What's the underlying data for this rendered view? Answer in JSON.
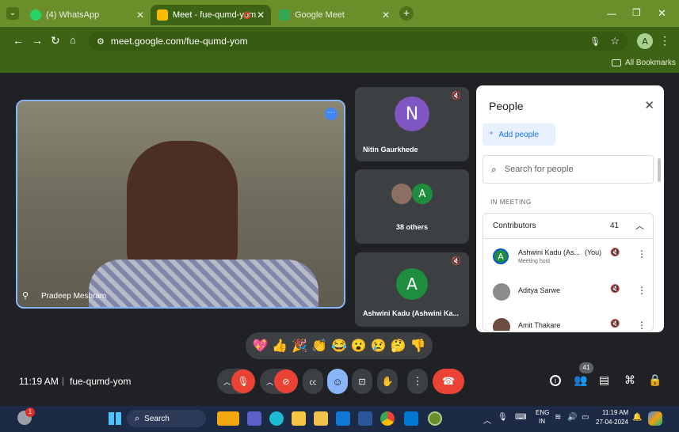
{
  "browser": {
    "tabs": [
      {
        "label": "(4) WhatsApp"
      },
      {
        "label": "Meet - fue-qumd-yom"
      },
      {
        "label": "Google Meet"
      }
    ],
    "url": "meet.google.com/fue-qumd-yom",
    "profile_initial": "A",
    "bookmarks_label": "All Bookmarks"
  },
  "meeting": {
    "main_tile_name": "Pradeep Meshram",
    "tiles": [
      {
        "initial": "N",
        "name": "Nitin Gaurkhede",
        "color": "#7e57c2"
      },
      {
        "initial": "A",
        "name": "38 others",
        "color": "#1e8e3e"
      },
      {
        "initial": "A",
        "name": "Ashwini Kadu (Ashwini Ka...",
        "color": "#1e8e3e"
      }
    ],
    "time": "11:19 AM",
    "divider": "|",
    "code": "fue-qumd-yom",
    "people_badge": "41"
  },
  "people_panel": {
    "title": "People",
    "add_people": "Add people",
    "search_placeholder": "Search for people",
    "section_label": "IN MEETING",
    "group_label": "Contributors",
    "group_count": "41",
    "members": [
      {
        "initial": "A",
        "name": "Ashwini Kadu (As...",
        "suffix": "(You)",
        "sub": "Meeting host"
      },
      {
        "initial": "",
        "name": "Aditya Sarwe",
        "suffix": "",
        "sub": ""
      },
      {
        "initial": "",
        "name": "Amit Thakare",
        "suffix": "",
        "sub": ""
      }
    ]
  },
  "reactions": [
    "💖",
    "👍",
    "🎉",
    "👏",
    "😂",
    "😮",
    "😢",
    "🤔",
    "👎"
  ],
  "taskbar": {
    "search_label": "Search",
    "lang": "ENG",
    "region": "IN",
    "clock_time": "11:19 AM",
    "clock_date": "27-04-2024",
    "notification_count": "1"
  },
  "colors": {
    "tab_bar": "#6a8f2a",
    "toolbar": "#3d6414",
    "meet_bg": "#202124",
    "mic_off_red": "#ea4335",
    "reactions_blue": "#8ab4f8"
  }
}
